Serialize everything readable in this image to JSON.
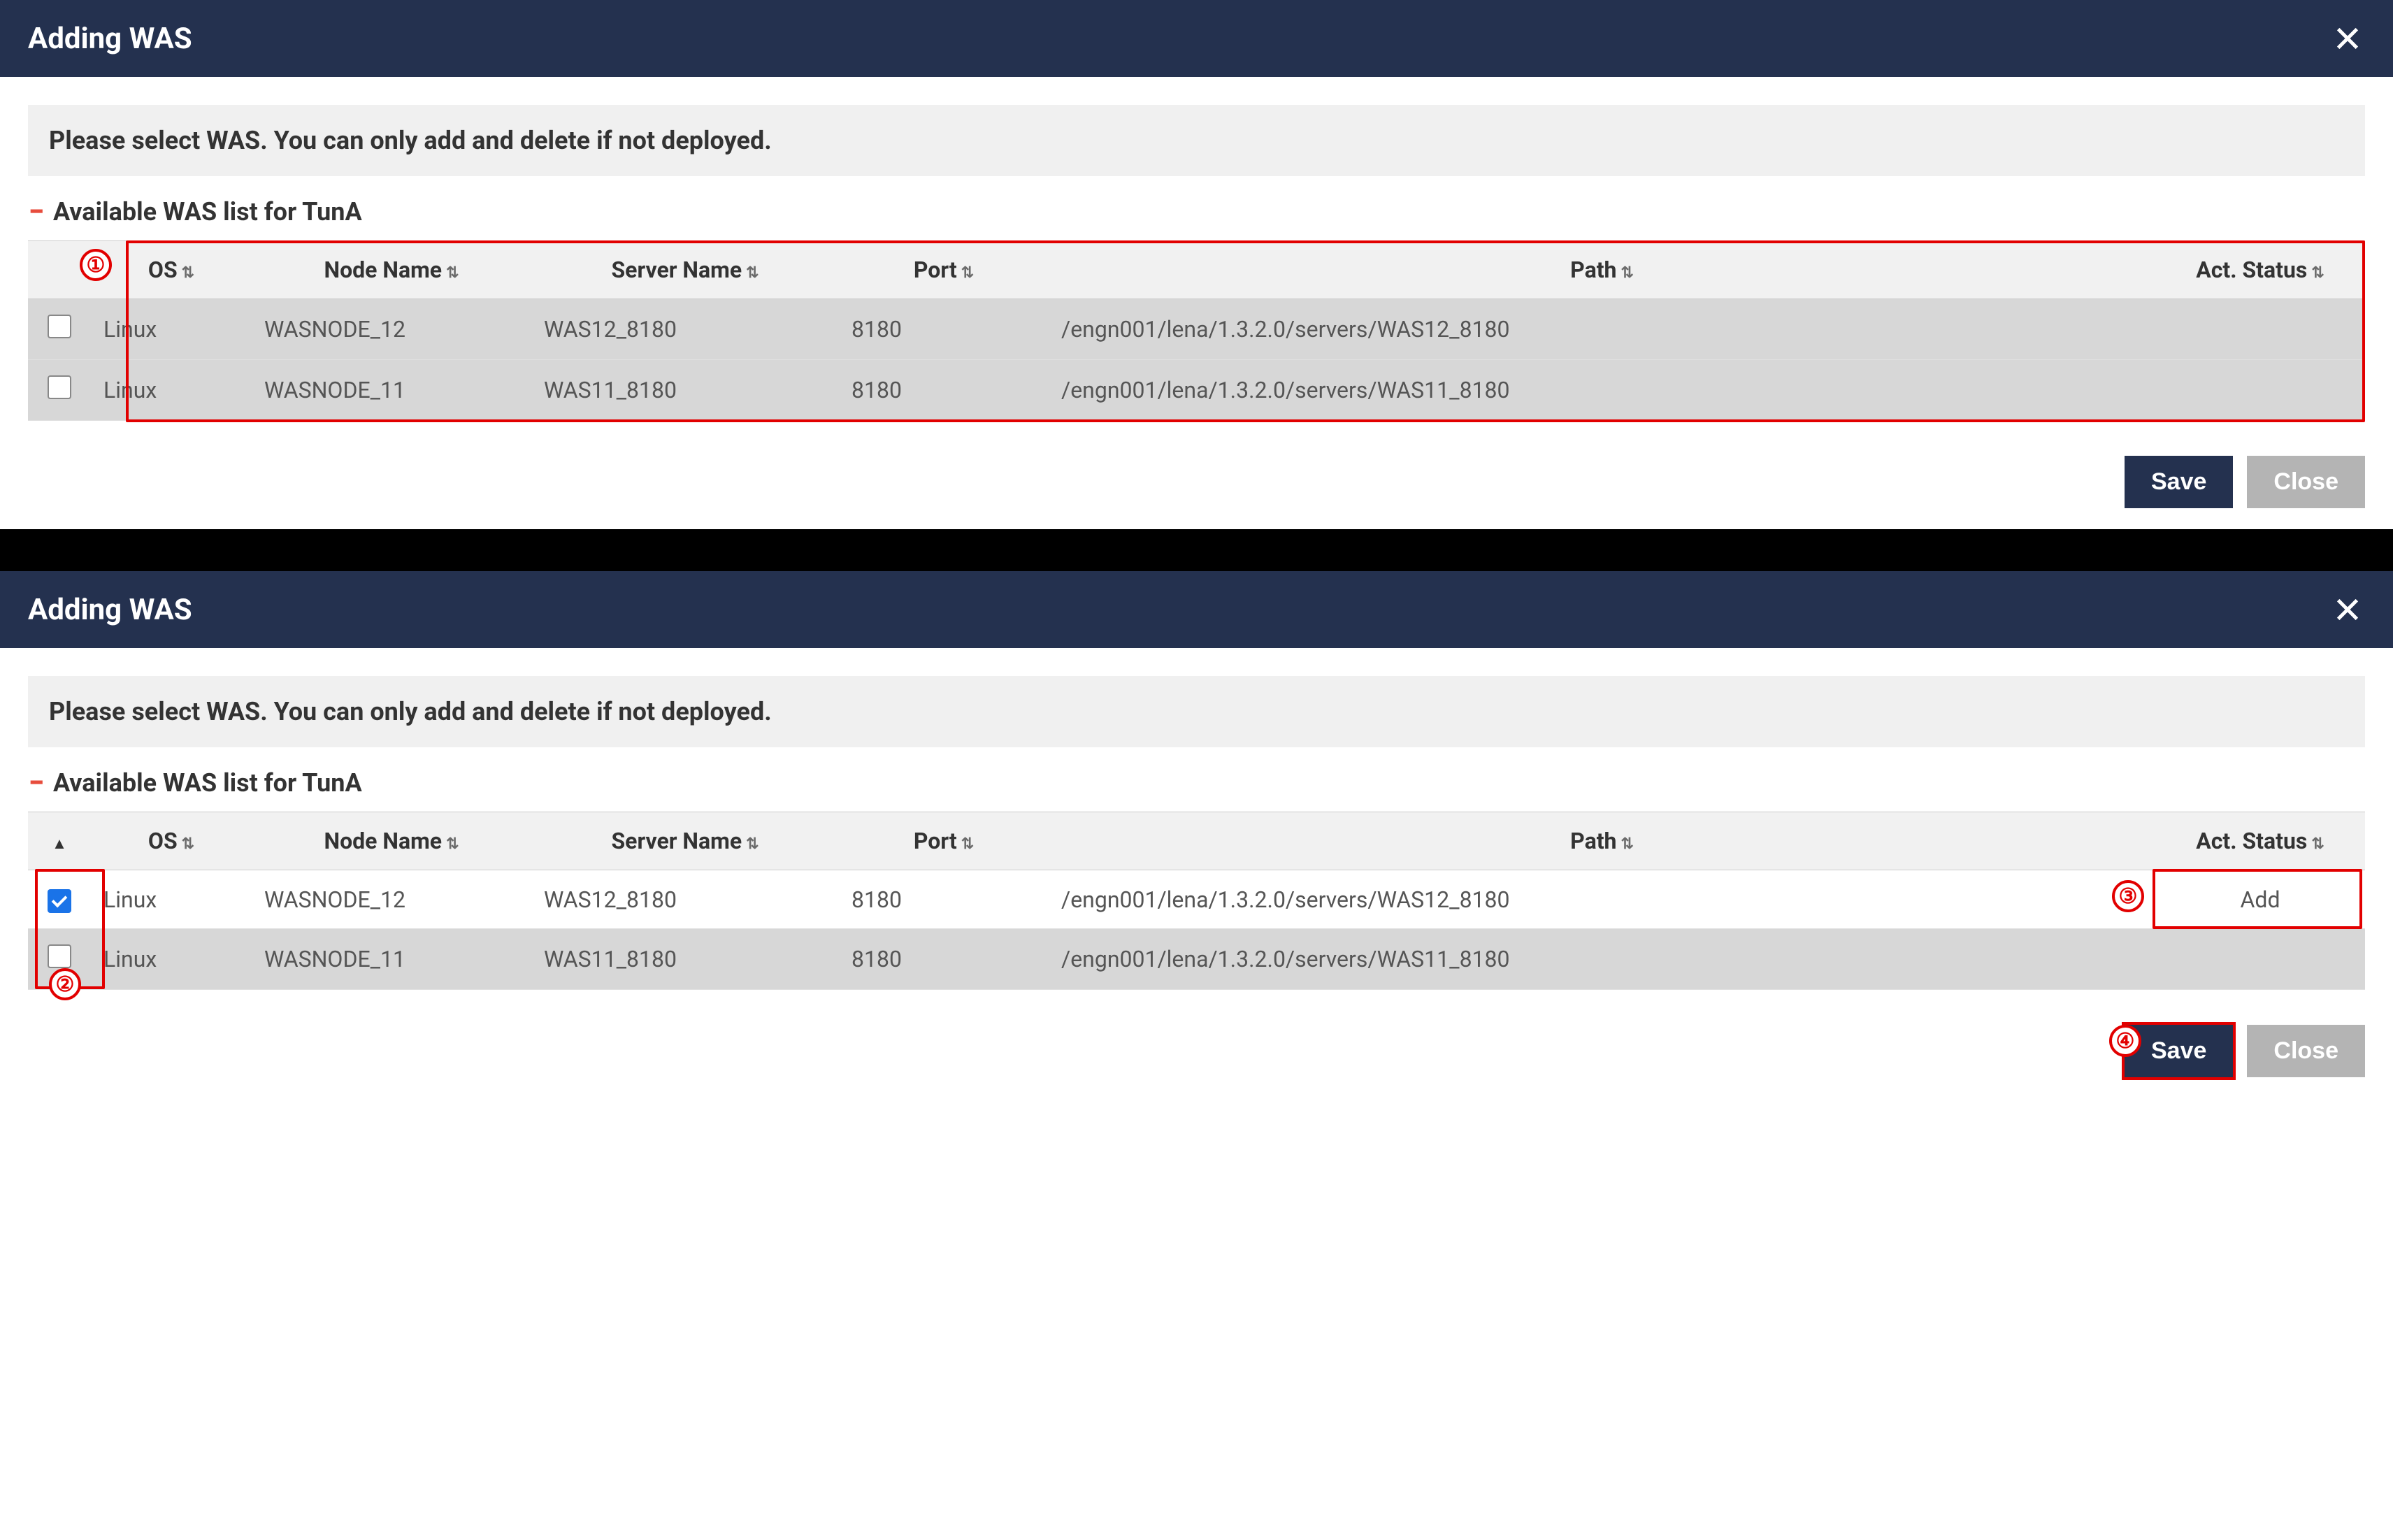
{
  "panel1": {
    "title": "Adding WAS",
    "info": "Please select WAS. You can only add and delete if not deployed.",
    "section": "Available WAS list for TunA",
    "columns": {
      "os": "OS",
      "node": "Node Name",
      "server": "Server Name",
      "port": "Port",
      "path": "Path",
      "status": "Act. Status"
    },
    "rows": [
      {
        "checked": false,
        "os": "Linux",
        "node": "WASNODE_12",
        "server": "WAS12_8180",
        "port": "8180",
        "path": "/engn001/lena/1.3.2.0/servers/WAS12_8180",
        "status": ""
      },
      {
        "checked": false,
        "os": "Linux",
        "node": "WASNODE_11",
        "server": "WAS11_8180",
        "port": "8180",
        "path": "/engn001/lena/1.3.2.0/servers/WAS11_8180",
        "status": ""
      }
    ],
    "buttons": {
      "save": "Save",
      "close": "Close"
    },
    "callout1": "①"
  },
  "panel2": {
    "title": "Adding WAS",
    "info": "Please select WAS. You can only add and delete if not deployed.",
    "section": "Available WAS list for TunA",
    "columns": {
      "os": "OS",
      "node": "Node Name",
      "server": "Server Name",
      "port": "Port",
      "path": "Path",
      "status": "Act. Status"
    },
    "rows": [
      {
        "checked": true,
        "os": "Linux",
        "node": "WASNODE_12",
        "server": "WAS12_8180",
        "port": "8180",
        "path": "/engn001/lena/1.3.2.0/servers/WAS12_8180",
        "status": "Add"
      },
      {
        "checked": false,
        "os": "Linux",
        "node": "WASNODE_11",
        "server": "WAS11_8180",
        "port": "8180",
        "path": "/engn001/lena/1.3.2.0/servers/WAS11_8180",
        "status": ""
      }
    ],
    "buttons": {
      "save": "Save",
      "close": "Close"
    },
    "callout2": "②",
    "callout3": "③",
    "callout4": "④"
  }
}
